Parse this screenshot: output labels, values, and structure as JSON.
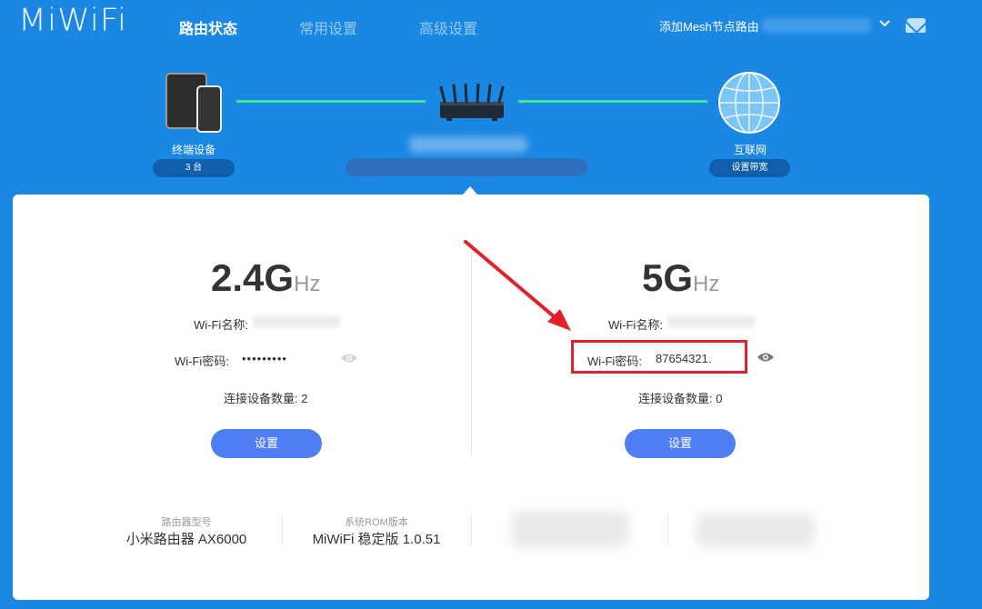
{
  "header": {
    "logo": "MiWiFi",
    "nav": [
      "路由状态",
      "常用设置",
      "高级设置"
    ],
    "mesh_label": "添加Mesh节点路由"
  },
  "topology": {
    "devices_label": "终端设备",
    "devices_count": "3 台",
    "internet_label": "互联网",
    "bandwidth_button": "设置带宽"
  },
  "wifi24": {
    "band": "2.4G",
    "unit": "Hz",
    "name_label": "Wi-Fi名称:",
    "password_label": "Wi-Fi密码:",
    "password_value": "•••••••••",
    "count_label": "连接设备数量:",
    "count": "2",
    "button": "设置"
  },
  "wifi5": {
    "band": "5G",
    "unit": "Hz",
    "name_label": "Wi-Fi名称:",
    "password_label": "Wi-Fi密码:",
    "password_value": "87654321.",
    "count_label": "连接设备数量:",
    "count": "0",
    "button": "设置"
  },
  "info": {
    "model_label": "路由器型号",
    "model_value": "小米路由器 AX6000",
    "rom_label": "系统ROM版本",
    "rom_value": "MiWiFi 稳定版 1.0.51"
  },
  "colors": {
    "background": "#1a87e3",
    "link_line": "#41e68f",
    "button": "#4f7ff2",
    "highlight": "#e2202a"
  }
}
